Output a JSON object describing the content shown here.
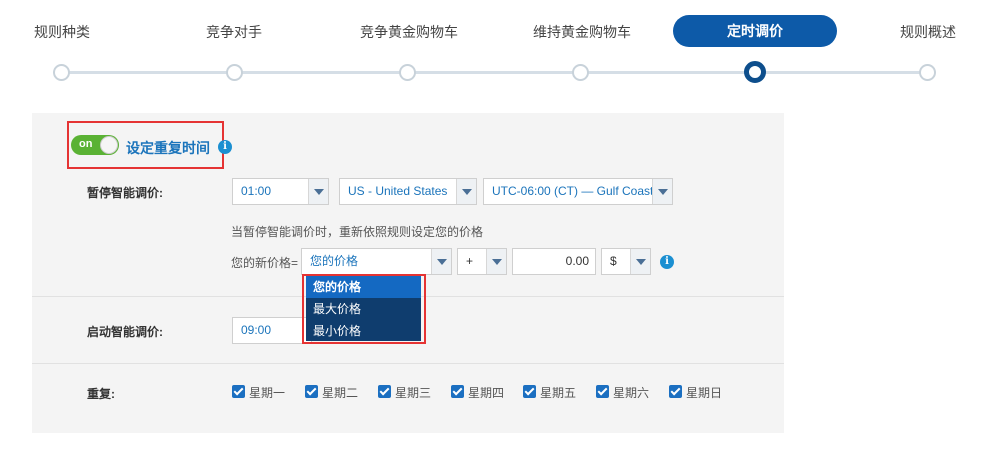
{
  "stepper": {
    "steps": [
      "规则种类",
      "竞争对手",
      "竞争黄金购物车",
      "维持黄金购物车",
      "定时调价",
      "规则概述"
    ],
    "active_index": 4
  },
  "schedule": {
    "toggle_label": "on",
    "toggle_on": true,
    "title": "设定重复时间",
    "info_icon": "i"
  },
  "pause": {
    "label": "暂停智能调价:",
    "time": "01:00",
    "country": "US - United States",
    "timezone": "UTC-06:00 (CT) — Gulf Coast",
    "hint": "当暂停智能调价时，重新依照规则设定您的价格",
    "new_price_label": "您的新价格=",
    "price_base": "您的价格",
    "operator": "+",
    "amount": "0.00",
    "unit": "$"
  },
  "price_dropdown": {
    "options": [
      "您的价格",
      "最大价格",
      "最小价格"
    ],
    "selected_index": 0
  },
  "resume": {
    "label": "启动智能调价:",
    "time": "09:00"
  },
  "repeat": {
    "label": "重复:",
    "days": [
      "星期一",
      "星期二",
      "星期三",
      "星期四",
      "星期五",
      "星期六",
      "星期日"
    ],
    "checked": [
      true,
      true,
      true,
      true,
      true,
      true,
      true
    ]
  },
  "colors": {
    "accent": "#0d5aa8",
    "toggle_on": "#5ab234",
    "highlight": "#e53333",
    "dropdown_bg": "#0f3d6e"
  }
}
